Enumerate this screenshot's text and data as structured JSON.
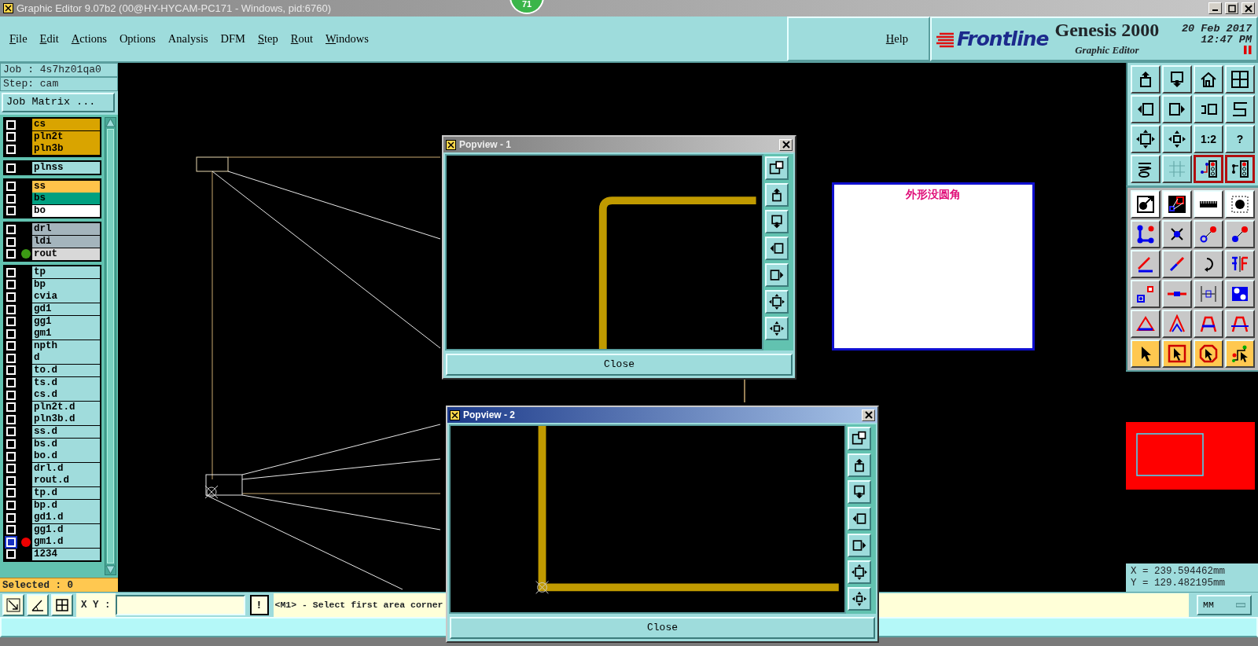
{
  "window": {
    "title": "Graphic Editor 9.07b2 (00@HY-HYCAM-PC171 - Windows, pid:6760)"
  },
  "notification_badge": "71",
  "menu": [
    {
      "label": "File",
      "underlined": true
    },
    {
      "label": "Edit",
      "underlined": true
    },
    {
      "label": "Actions",
      "underlined": true
    },
    {
      "label": "Options",
      "underlined": false
    },
    {
      "label": "Analysis",
      "underlined": false
    },
    {
      "label": "DFM",
      "underlined": false
    },
    {
      "label": "Step",
      "underlined": true
    },
    {
      "label": "Rout",
      "underlined": true
    },
    {
      "label": "Windows",
      "underlined": true
    }
  ],
  "help": "Help",
  "brand": {
    "logo": "Frontline",
    "product": "Genesis 2000",
    "subtitle": "Graphic Editor",
    "date": "20 Feb 2017",
    "time": "12:47 PM"
  },
  "job": {
    "job_label": "Job : 4s7hz01qa0",
    "step_label": "Step: cam",
    "matrix_button": "Job Matrix ..."
  },
  "layer_groups": [
    {
      "layers": [
        {
          "name": "cs",
          "color": "#d9a400",
          "selected": false
        },
        {
          "name": "pln2t",
          "color": "#d9a400",
          "selected": false
        },
        {
          "name": "pln3b",
          "color": "#d9a400",
          "selected": false
        }
      ]
    },
    {
      "layers": [
        {
          "name": "plnss",
          "color": "#a0dcdc",
          "selected": false
        }
      ]
    },
    {
      "layers": [
        {
          "name": "ss",
          "color": "#ffc34a",
          "selected": false
        },
        {
          "name": "bs",
          "color": "#00a080",
          "selected": false
        },
        {
          "name": "bo",
          "color": "#ffffff",
          "selected": false
        }
      ]
    },
    {
      "layers": [
        {
          "name": "drl",
          "color": "#a4b4bc",
          "selected": false
        },
        {
          "name": "ldi",
          "color": "#a4b4bc",
          "selected": false
        },
        {
          "name": "rout",
          "color": "#d8d8d8",
          "selected": false,
          "dot": {
            "color": "#3c9a14"
          }
        }
      ]
    },
    {
      "layers": [
        {
          "name": "tp",
          "color": "#a0dcdc",
          "selected": false
        },
        {
          "name": "bp",
          "color": "#a0dcdc",
          "selected": false
        },
        {
          "name": "cvia",
          "color": "#a0dcdc",
          "selected": false
        },
        {
          "name": "gd1",
          "color": "#a0dcdc",
          "selected": false
        },
        {
          "name": "gg1",
          "color": "#a0dcdc",
          "selected": false
        },
        {
          "name": "gm1",
          "color": "#a0dcdc",
          "selected": false
        },
        {
          "name": "npth",
          "color": "#a0dcdc",
          "selected": false
        },
        {
          "name": "d",
          "color": "#a0dcdc",
          "selected": false
        },
        {
          "name": "to.d",
          "color": "#a0dcdc",
          "selected": false
        },
        {
          "name": "ts.d",
          "color": "#a0dcdc",
          "selected": false
        },
        {
          "name": "cs.d",
          "color": "#a0dcdc",
          "selected": false
        },
        {
          "name": "pln2t.d",
          "color": "#a0dcdc",
          "selected": false
        },
        {
          "name": "pln3b.d",
          "color": "#a0dcdc",
          "selected": false
        },
        {
          "name": "ss.d",
          "color": "#a0dcdc",
          "selected": false
        },
        {
          "name": "bs.d",
          "color": "#a0dcdc",
          "selected": false
        },
        {
          "name": "bo.d",
          "color": "#a0dcdc",
          "selected": false
        },
        {
          "name": "drl.d",
          "color": "#a0dcdc",
          "selected": false
        },
        {
          "name": "rout.d",
          "color": "#a0dcdc",
          "selected": false
        },
        {
          "name": "tp.d",
          "color": "#a0dcdc",
          "selected": false
        },
        {
          "name": "bp.d",
          "color": "#a0dcdc",
          "selected": false
        },
        {
          "name": "gd1.d",
          "color": "#a0dcdc",
          "selected": false
        },
        {
          "name": "gg1.d",
          "color": "#a0dcdc",
          "selected": false
        },
        {
          "name": "gm1.d",
          "color": "#a0dcdc",
          "selected": true,
          "dot": {
            "color": "#ee0000"
          }
        },
        {
          "name": "1234",
          "color": "#a0dcdc",
          "selected": false
        }
      ]
    }
  ],
  "selected_count": "Selected : 0",
  "toolbar": [
    {
      "kind": "view",
      "on": false
    },
    {
      "kind": "view",
      "on": false
    },
    {
      "kind": "view",
      "on": false
    },
    {
      "kind": "view",
      "on": false
    },
    {
      "kind": "view",
      "on": false
    },
    {
      "kind": "view",
      "on": false
    },
    {
      "kind": "view",
      "on": false
    },
    {
      "kind": "view",
      "on": false
    },
    {
      "kind": "view",
      "on": false
    },
    {
      "kind": "view",
      "on": false
    },
    {
      "kind": "view",
      "on": false,
      "label": "1:2"
    },
    {
      "kind": "view",
      "on": false,
      "label": "?"
    },
    {
      "kind": "view",
      "on": false
    },
    {
      "kind": "view",
      "on": false
    },
    {
      "kind": "view",
      "on": true
    },
    {
      "kind": "view",
      "on": true
    },
    {
      "kind": "display",
      "on": false
    },
    {
      "kind": "display",
      "on": false
    },
    {
      "kind": "display",
      "on": false
    },
    {
      "kind": "display",
      "on": false
    },
    {
      "kind": "edit",
      "on": false
    },
    {
      "kind": "edit",
      "on": false
    },
    {
      "kind": "edit",
      "on": false
    },
    {
      "kind": "edit",
      "on": false
    },
    {
      "kind": "edit",
      "on": false
    },
    {
      "kind": "edit",
      "on": false
    },
    {
      "kind": "edit",
      "on": false
    },
    {
      "kind": "edit",
      "on": false
    },
    {
      "kind": "edit",
      "on": false
    },
    {
      "kind": "edit",
      "on": false
    },
    {
      "kind": "edit",
      "on": false
    },
    {
      "kind": "edit",
      "on": false
    },
    {
      "kind": "edit",
      "on": false
    },
    {
      "kind": "edit",
      "on": false
    },
    {
      "kind": "edit",
      "on": false
    },
    {
      "kind": "edit",
      "on": false
    },
    {
      "kind": "select",
      "on": false
    },
    {
      "kind": "select",
      "on": false
    },
    {
      "kind": "select",
      "on": false
    },
    {
      "kind": "select",
      "on": false
    }
  ],
  "coordinates": [
    "X = 239.594462mm",
    "Y = 129.482195mm"
  ],
  "note": "外形没圆角",
  "popviews": [
    {
      "title": "Popview - 1",
      "active": false,
      "close_button": "Close"
    },
    {
      "title": "Popview - 2",
      "active": true,
      "close_button": "Close"
    }
  ],
  "bottom_bar": {
    "xy_label": "X Y :",
    "confirm_button": "!",
    "message": "<M1> - Select first area corner",
    "units": "MM"
  }
}
